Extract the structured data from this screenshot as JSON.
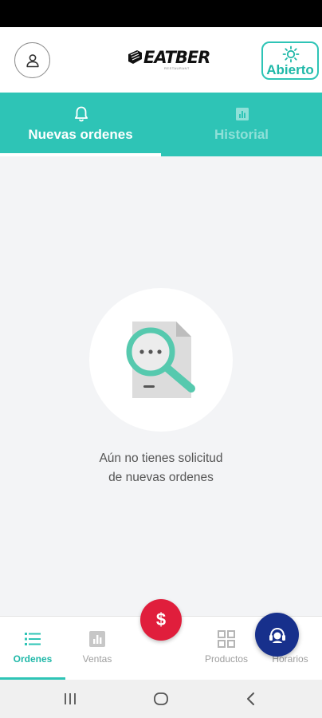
{
  "header": {
    "logo_text": "EATBER",
    "logo_subtext": "RESTAURANT",
    "status_label": "Abierto",
    "icons": {
      "profile": "person-icon",
      "status": "sun-icon"
    }
  },
  "tabs": [
    {
      "label": "Nuevas ordenes",
      "icon": "bell-icon",
      "active": true
    },
    {
      "label": "Historial",
      "icon": "chart-icon",
      "active": false
    }
  ],
  "empty_state": {
    "icon": "document-search-icon",
    "message_line1": "Aún no tienes solicitud",
    "message_line2": "de nuevas ordenes"
  },
  "bottom_nav": [
    {
      "label": "Ordenes",
      "icon": "list-icon",
      "active": true
    },
    {
      "label": "Ventas",
      "icon": "bar-chart-icon",
      "active": false
    },
    {
      "label": "Productos",
      "icon": "grid-icon",
      "active": false
    },
    {
      "label": "Horarios",
      "icon": "clock-icon",
      "active": false
    }
  ],
  "fabs": {
    "money_symbol": "$",
    "support_icon": "support-agent-icon"
  },
  "colors": {
    "primary": "#2ec4b6",
    "fab_red": "#e01e3c",
    "fab_navy": "#17308c",
    "background": "#f3f4f6"
  }
}
